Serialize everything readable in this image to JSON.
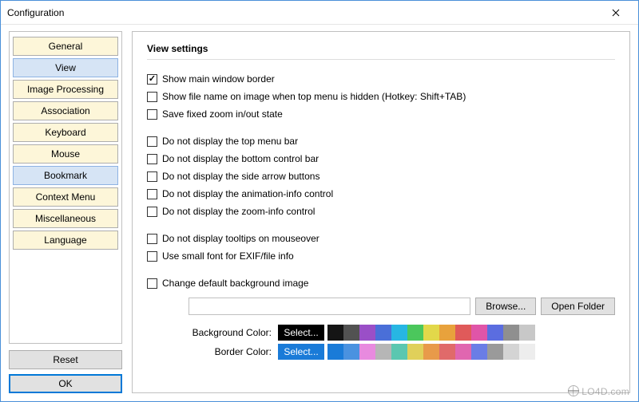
{
  "window": {
    "title": "Configuration"
  },
  "sidebar": {
    "items": [
      {
        "label": "General",
        "selected": false
      },
      {
        "label": "View",
        "selected": true
      },
      {
        "label": "Image Processing",
        "selected": false
      },
      {
        "label": "Association",
        "selected": false
      },
      {
        "label": "Keyboard",
        "selected": false
      },
      {
        "label": "Mouse",
        "selected": false
      },
      {
        "label": "Bookmark",
        "selected": false
      },
      {
        "label": "Context Menu",
        "selected": false
      },
      {
        "label": "Miscellaneous",
        "selected": false
      },
      {
        "label": "Language",
        "selected": false
      }
    ],
    "reset": "Reset",
    "ok": "OK"
  },
  "panel": {
    "heading": "View settings",
    "group1": [
      {
        "label": "Show main window border",
        "checked": true
      },
      {
        "label": "Show file name on image when top menu is hidden (Hotkey: Shift+TAB)",
        "checked": false
      },
      {
        "label": "Save fixed zoom in/out state",
        "checked": false
      }
    ],
    "group2": [
      {
        "label": "Do not display the top menu bar",
        "checked": false
      },
      {
        "label": "Do not display the bottom control bar",
        "checked": false
      },
      {
        "label": "Do not display the side arrow buttons",
        "checked": false
      },
      {
        "label": "Do not display the animation-info control",
        "checked": false
      },
      {
        "label": "Do not display the zoom-info control",
        "checked": false
      }
    ],
    "group3": [
      {
        "label": "Do not display tooltips on mouseover",
        "checked": false
      },
      {
        "label": "Use small font for EXIF/file info",
        "checked": false
      }
    ],
    "bgimage": {
      "label": "Change default background image",
      "checked": false
    },
    "path_value": "",
    "browse": "Browse...",
    "open_folder": "Open Folder",
    "bg_color_label": "Background Color:",
    "border_color_label": "Border Color:",
    "select_label": "Select...",
    "swatches": [
      "#151515",
      "#525252",
      "#9a4fc7",
      "#4a6fd8",
      "#27b6e3",
      "#4bc75c",
      "#e2d84a",
      "#e8a23c",
      "#e05a5a",
      "#e055a8",
      "#5b6de0",
      "#8f8f8f",
      "#c8c8c8"
    ],
    "swatches2": [
      "#1a7bd8",
      "#4a92e0",
      "#e88adf",
      "#b6b6b6",
      "#5bc7b0",
      "#e0d05a",
      "#e89a4a",
      "#e06a6a",
      "#e066b0",
      "#6a7de6",
      "#9a9a9a",
      "#d4d4d4",
      "#ededed"
    ]
  },
  "watermark": "LO4D.com"
}
